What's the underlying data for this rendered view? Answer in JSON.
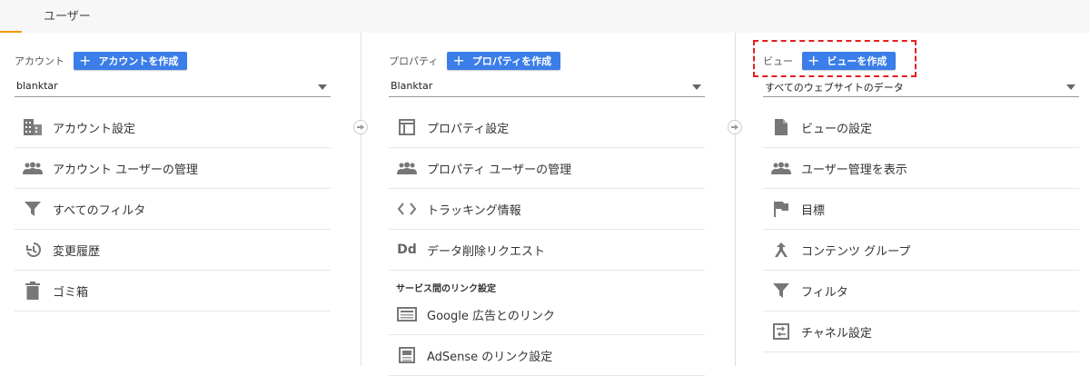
{
  "tabs": {
    "user_label": "ユーザー"
  },
  "account": {
    "title": "アカウント",
    "create_label": "アカウントを作成",
    "selected": "blanktar",
    "items": [
      {
        "label": "アカウント設定",
        "icon": "building-icon"
      },
      {
        "label": "アカウント ユーザーの管理",
        "icon": "users-icon"
      },
      {
        "label": "すべてのフィルタ",
        "icon": "filter-icon"
      },
      {
        "label": "変更履歴",
        "icon": "history-icon"
      },
      {
        "label": "ゴミ箱",
        "icon": "trash-icon"
      }
    ]
  },
  "property": {
    "title": "プロパティ",
    "create_label": "プロパティを作成",
    "selected": "Blanktar",
    "items": [
      {
        "label": "プロパティ設定",
        "icon": "window-icon"
      },
      {
        "label": "プロパティ ユーザーの管理",
        "icon": "users-icon"
      },
      {
        "label": "トラッキング情報",
        "icon": "code-icon"
      },
      {
        "label": "データ削除リクエスト",
        "icon": "dd-icon",
        "icon_text": "Dd"
      }
    ],
    "section_label": "サービス間のリンク設定",
    "link_items": [
      {
        "label": "Google 広告とのリンク",
        "icon": "ads-icon"
      },
      {
        "label": "AdSense のリンク設定",
        "icon": "adsense-icon"
      }
    ]
  },
  "view": {
    "title": "ビュー",
    "create_label": "ビューを作成",
    "selected": "すべてのウェブサイトのデータ",
    "items": [
      {
        "label": "ビューの設定",
        "icon": "document-icon"
      },
      {
        "label": "ユーザー管理を表示",
        "icon": "users-icon"
      },
      {
        "label": "目標",
        "icon": "flag-icon"
      },
      {
        "label": "コンテンツ グループ",
        "icon": "content-group-icon"
      },
      {
        "label": "フィルタ",
        "icon": "filter-icon"
      },
      {
        "label": "チャネル設定",
        "icon": "channel-icon"
      }
    ]
  },
  "colors": {
    "accent": "#3b7de9",
    "tab_indicator": "#f29900",
    "highlight": "#e02020"
  }
}
